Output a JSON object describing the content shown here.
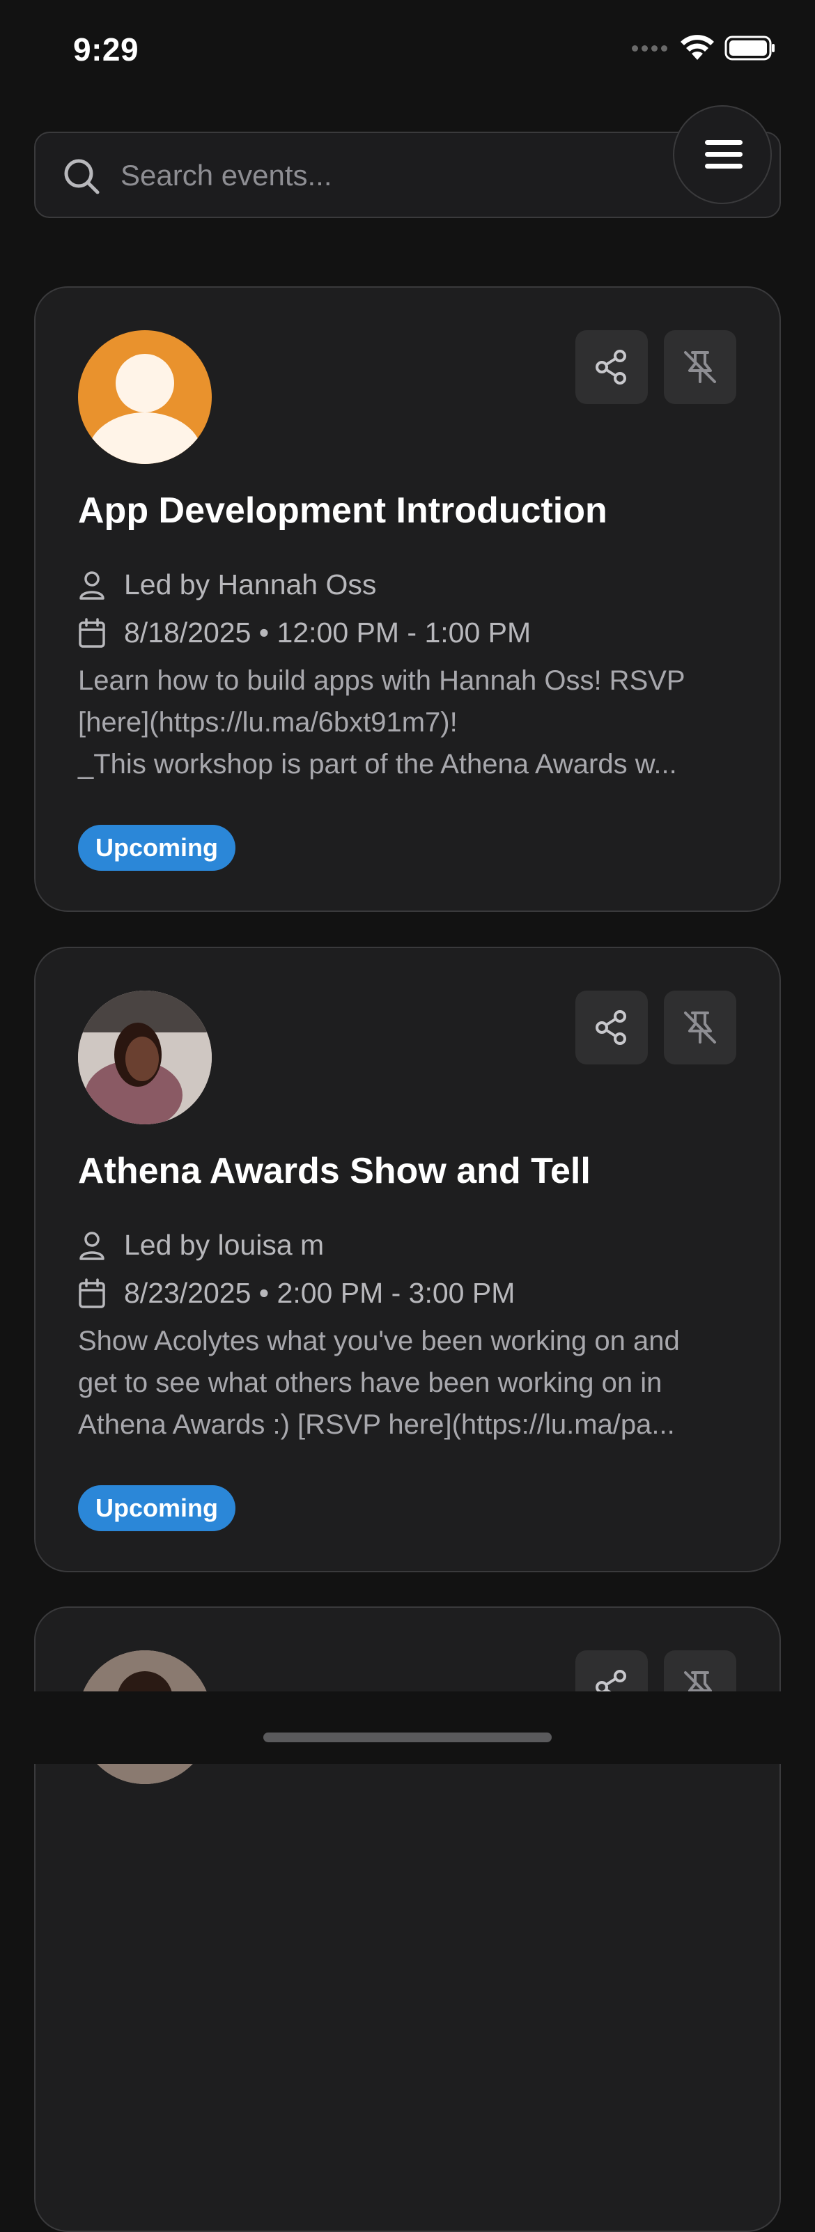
{
  "status_bar": {
    "time": "9:29"
  },
  "search": {
    "placeholder": "Search events..."
  },
  "colors": {
    "background": "#121212",
    "card": "#1e1e1f",
    "badge": "#2b87d8",
    "default_avatar": "#e9922d"
  },
  "events": [
    {
      "title": "App Development Introduction",
      "leader": "Led by Hannah Oss",
      "datetime": "8/18/2025 • 12:00 PM - 1:00 PM",
      "description": "Learn how to build apps with Hannah Oss! RSVP\n[here](https://lu.ma/6bxt91m7)!\n_This workshop is part of the Athena Awards w...",
      "status": "Upcoming",
      "avatar": "default-avatar-icon"
    },
    {
      "title": "Athena Awards Show and Tell",
      "leader": "Led by louisa m",
      "datetime": "8/23/2025 • 2:00 PM - 3:00 PM",
      "description": "Show Acolytes what you've been working on and\nget to see what others have been working on in\nAthena Awards :) [RSVP here](https://lu.ma/pa...",
      "status": "Upcoming",
      "avatar": "profile-photo"
    }
  ],
  "icons": {
    "share": "share-icon",
    "unpin": "pin-off-icon",
    "leader": "person-icon",
    "date": "calendar-icon",
    "menu": "hamburger-menu-icon",
    "search": "search-icon"
  }
}
